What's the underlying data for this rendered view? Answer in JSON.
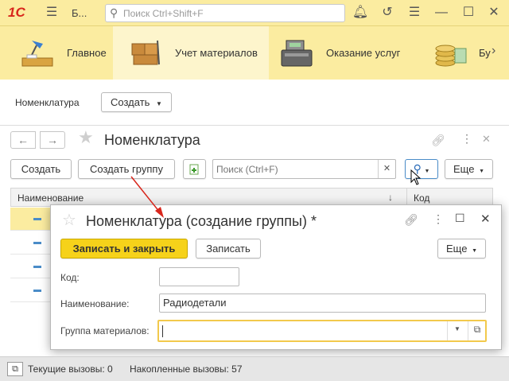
{
  "titlebar": {
    "logo": "1С",
    "app_short": "Б...",
    "search_placeholder": "Поиск Ctrl+Shift+F"
  },
  "sections": [
    {
      "label": "Главное"
    },
    {
      "label": "Учет материалов"
    },
    {
      "label": "Оказание услуг"
    },
    {
      "label": "Бу"
    }
  ],
  "navbar": {
    "label": "Номенклатура",
    "create_label": "Создать"
  },
  "mainform": {
    "title": "Номенклатура",
    "create_label": "Создать",
    "create_group_label": "Создать группу",
    "search_placeholder": "Поиск (Ctrl+F)",
    "more_label": "Еще",
    "columns": [
      "Наименование",
      "Код"
    ],
    "sort_indicator": "↓"
  },
  "modal": {
    "title": "Номенклатура (создание группы) *",
    "save_close_label": "Записать и закрыть",
    "save_label": "Записать",
    "more_label": "Еще",
    "code_label": "Код:",
    "code_value": "",
    "name_label": "Наименование:",
    "name_value": "Радиодетали",
    "group_label": "Группа материалов:",
    "group_value": ""
  },
  "statusbar": {
    "current_calls": "Текущие вызовы: 0",
    "accumulated_calls": "Накопленные вызовы: 57"
  },
  "colors": {
    "accent_yellow": "#fbeca0",
    "primary_button": "#f6d21a",
    "annotation_arrow": "#d8261c",
    "search_highlight": "#4a8cc8"
  }
}
